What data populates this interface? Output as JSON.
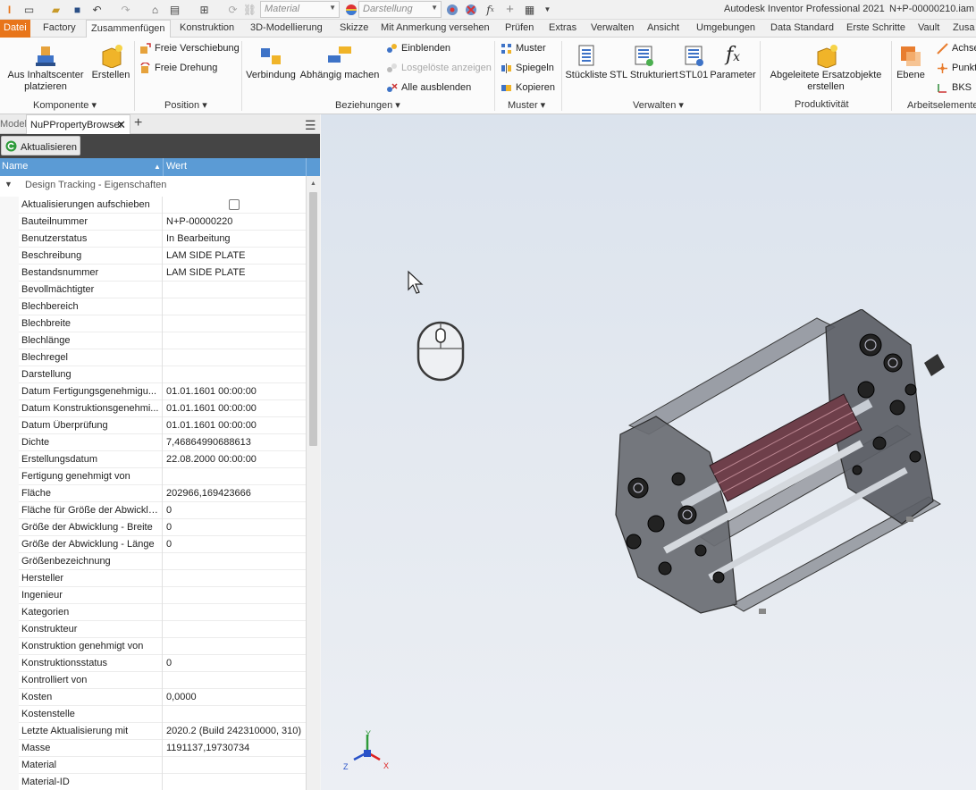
{
  "title_bar": {
    "material_placeholder": "Material",
    "appearance_placeholder": "Darstellung",
    "app_title": "Autodesk Inventor Professional 2021",
    "document_name": "N+P-00000210.iam"
  },
  "tabs": [
    "Datei",
    "Factory",
    "Zusammenfügen",
    "Konstruktion",
    "3D-Modellierung",
    "Skizze",
    "Mit Anmerkung versehen",
    "Prüfen",
    "Extras",
    "Verwalten",
    "Ansicht",
    "Umgebungen",
    "Data Standard",
    "Erste Schritte",
    "Vault",
    "Zusa"
  ],
  "ribbon": {
    "komponente": {
      "place_cc_line1": "Aus Inhaltscenter",
      "place_cc_line2": "platzieren",
      "create": "Erstellen",
      "group": "Komponente"
    },
    "position": {
      "free_move": "Freie Verschiebung",
      "free_rotate": "Freie Drehung",
      "group": "Position"
    },
    "beziehungen": {
      "joint": "Verbindung",
      "constrain": "Abhängig machen",
      "show": "Einblenden",
      "show_sick": "Losgelöste anzeigen",
      "hide_all": "Alle ausblenden",
      "group": "Beziehungen"
    },
    "muster": {
      "pattern": "Muster",
      "mirror": "Spiegeln",
      "copy": "Kopieren",
      "group": "Muster"
    },
    "verwalten": {
      "bom": "Stückliste",
      "stl_struct": "STL Strukturiert",
      "stl01": "STL01",
      "params": "Parameter",
      "group": "Verwalten"
    },
    "produktivitaet": {
      "derived_line1": "Abgeleitete Ersatzobjekte",
      "derived_line2": "erstellen",
      "group": "Produktivität"
    },
    "arbeitselemente": {
      "plane": "Ebene",
      "axis": "Achse",
      "point": "Punkt",
      "ucs": "BKS",
      "group": "Arbeitselemente"
    }
  },
  "panel": {
    "tab_model": "Modell",
    "tab_browser": "NuPPropertyBrowser",
    "refresh_label": "Aktualisieren",
    "col_name": "Name",
    "col_value": "Wert",
    "group_label": "Design Tracking - Eigenschaften",
    "rows": [
      {
        "k": "Aktualisierungen aufschieben",
        "v": ""
      },
      {
        "k": "Bauteilnummer",
        "v": "N+P-00000220"
      },
      {
        "k": "Benutzerstatus",
        "v": "In Bearbeitung"
      },
      {
        "k": "Beschreibung",
        "v": "LAM SIDE PLATE"
      },
      {
        "k": "Bestandsnummer",
        "v": "LAM SIDE PLATE"
      },
      {
        "k": "Bevollmächtigter",
        "v": ""
      },
      {
        "k": "Blechbereich",
        "v": ""
      },
      {
        "k": "Blechbreite",
        "v": ""
      },
      {
        "k": "Blechlänge",
        "v": ""
      },
      {
        "k": "Blechregel",
        "v": ""
      },
      {
        "k": "Darstellung",
        "v": ""
      },
      {
        "k": "Datum Fertigungsgenehmigu...",
        "v": "01.01.1601 00:00:00"
      },
      {
        "k": "Datum Konstruktionsgenehmi...",
        "v": "01.01.1601 00:00:00"
      },
      {
        "k": "Datum Überprüfung",
        "v": "01.01.1601 00:00:00"
      },
      {
        "k": "Dichte",
        "v": "7,46864990688613"
      },
      {
        "k": "Erstellungsdatum",
        "v": "22.08.2000 00:00:00"
      },
      {
        "k": "Fertigung genehmigt von",
        "v": ""
      },
      {
        "k": "Fläche",
        "v": "202966,169423666"
      },
      {
        "k": "Fläche für Größe der Abwicklu...",
        "v": "0"
      },
      {
        "k": "Größe der Abwicklung - Breite",
        "v": "0"
      },
      {
        "k": "Größe der Abwicklung - Länge",
        "v": "0"
      },
      {
        "k": "Größenbezeichnung",
        "v": ""
      },
      {
        "k": "Hersteller",
        "v": ""
      },
      {
        "k": "Ingenieur",
        "v": ""
      },
      {
        "k": "Kategorien",
        "v": ""
      },
      {
        "k": "Konstrukteur",
        "v": ""
      },
      {
        "k": "Konstruktion genehmigt von",
        "v": ""
      },
      {
        "k": "Konstruktionsstatus",
        "v": "0"
      },
      {
        "k": "Kontrolliert von",
        "v": ""
      },
      {
        "k": "Kosten",
        "v": "0,0000"
      },
      {
        "k": "Kostenstelle",
        "v": ""
      },
      {
        "k": "Letzte Aktualisierung mit",
        "v": "2020.2 (Build 242310000, 310)"
      },
      {
        "k": "Masse",
        "v": "1191137,19730734"
      },
      {
        "k": "Material",
        "v": ""
      },
      {
        "k": "Material-ID",
        "v": ""
      }
    ]
  },
  "viewport": {
    "axis_x": "X",
    "axis_y": "Y",
    "axis_z": "Z"
  },
  "colors": {
    "file_tab": "#e8751a",
    "header_blue": "#5b9bd5",
    "panel_toolbar": "#454545"
  }
}
